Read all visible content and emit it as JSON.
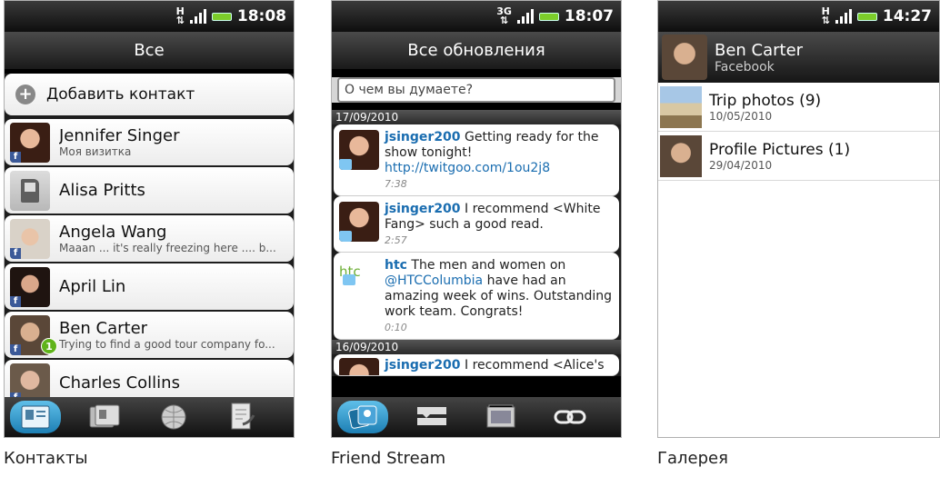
{
  "phones": {
    "contacts": {
      "status_time": "18:08",
      "title": "Все",
      "add_contact": "Добавить контакт",
      "contacts": [
        {
          "name": "Jennifer Singer",
          "sub": "Моя визитка"
        },
        {
          "name": "Alisa Pritts",
          "sub": ""
        },
        {
          "name": "Angela Wang",
          "sub": "Maaan ... it's really freezing here .... b..."
        },
        {
          "name": "April  Lin",
          "sub": ""
        },
        {
          "name": "Ben  Carter",
          "sub": "Trying to find a good tour company fo...",
          "badge": "1"
        },
        {
          "name": "Charles  Collins",
          "sub": ""
        }
      ],
      "caption": "Контакты"
    },
    "friend_stream": {
      "status_time": "18:07",
      "title": "Все обновления",
      "search_placeholder": "О чем вы думаете?",
      "date1": "17/09/2010",
      "posts": [
        {
          "user": "jsinger200",
          "text": " Getting ready for the show tonight! ",
          "link": "http://twitgoo.com/1ou2j8",
          "time": "7:38"
        },
        {
          "user": "jsinger200",
          "text": " I recommend <White Fang>  such a good read.",
          "link": "",
          "time": "2:57"
        },
        {
          "user": "htc",
          "text_before": " The men and women on ",
          "link": "@HTCColumbia",
          "text_after": " have had an amazing week of wins. Outstanding work team. Congrats!",
          "time": "0:10",
          "logo": "htc"
        }
      ],
      "date2": "16/09/2010",
      "post4_preview": {
        "user": "jsinger200",
        "text": " I recommend <Alice's"
      },
      "caption": "Friend Stream"
    },
    "gallery": {
      "status_time": "14:27",
      "profile_name": "Ben Carter",
      "profile_source": "Facebook",
      "albums": [
        {
          "title": "Trip photos",
          "count": "(9)",
          "date": "10/05/2010"
        },
        {
          "title": "Profile Pictures",
          "count": "(1)",
          "date": "29/04/2010"
        }
      ],
      "caption": "Галерея"
    }
  },
  "icons": [
    "signal-icon",
    "battery-icon",
    "facebook-icon",
    "twitter-icon",
    "plus-icon",
    "sim-icon",
    "contacts-tab-icon",
    "groups-tab-icon",
    "web-tab-icon",
    "call-history-tab-icon",
    "people-tab-icon",
    "stream-tab-icon",
    "photos-tab-icon",
    "links-tab-icon"
  ],
  "colors": {
    "accent_blue": "#1a6db0",
    "badge_green": "#5fb319",
    "htc_green": "#6cae34",
    "facebook": "#3b5998"
  }
}
